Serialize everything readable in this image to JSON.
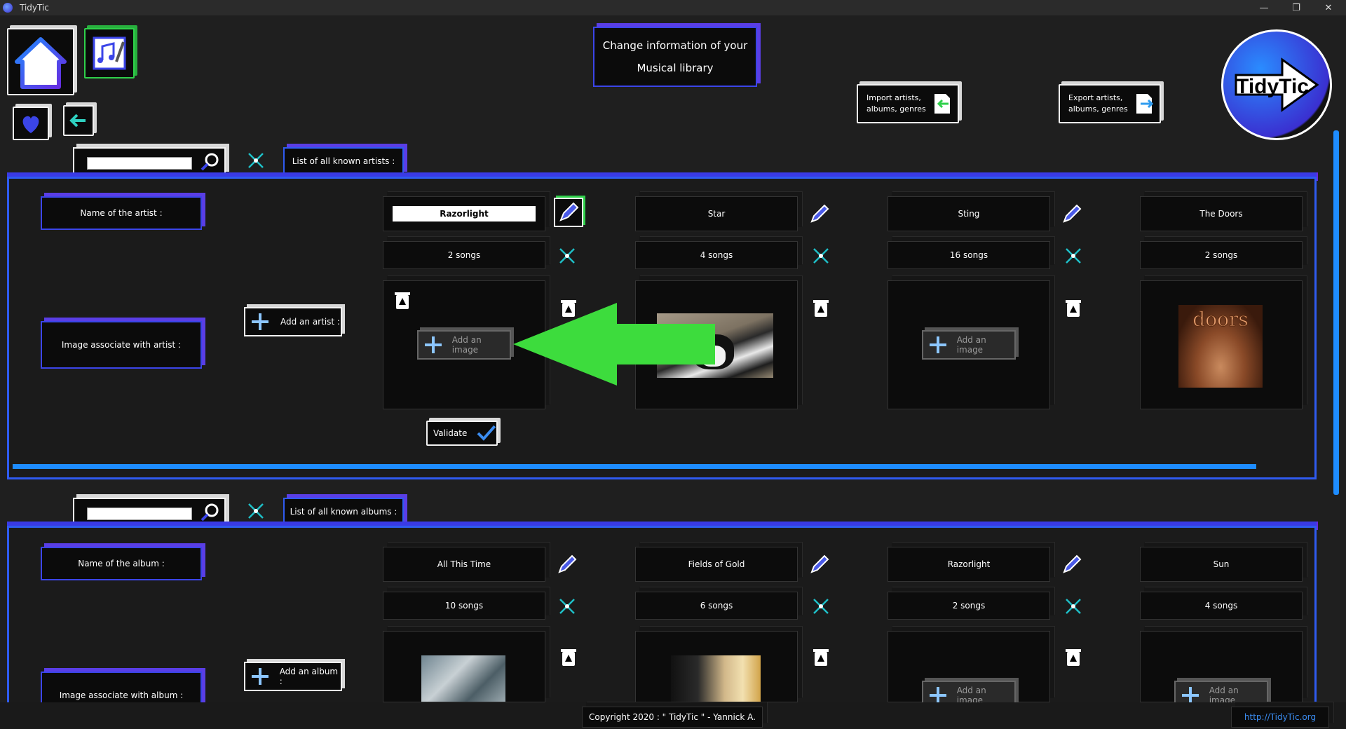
{
  "window": {
    "title": "TidyTic",
    "minimize": "—",
    "restore": "❐",
    "close": "✕"
  },
  "header": {
    "title_line1": "Change information of your",
    "title_line2": "Musical library",
    "import_label_1": "Import artists,",
    "import_label_2": "albums, genres",
    "export_label_1": "Export artists,",
    "export_label_2": "albums, genres",
    "logo_text": "TidyTic"
  },
  "artists": {
    "tab_label": "List of all known artists :",
    "name_label": "Name of the artist :",
    "image_label": "Image associate with artist :",
    "add_label": "Add an artist :",
    "validate_label": "Validate",
    "add_image_label": "Add an image",
    "items": [
      {
        "name": "Razorlight",
        "songs": "2 songs",
        "image": "none",
        "editing": true
      },
      {
        "name": "Star",
        "songs": "4 songs",
        "image": "dog-photo"
      },
      {
        "name": "Sting",
        "songs": "16 songs",
        "image": "none"
      },
      {
        "name": "The Doors",
        "songs": "2 songs",
        "image": "doors-cover"
      }
    ]
  },
  "albums": {
    "tab_label": "List of all known albums :",
    "name_label": "Name of the album :",
    "image_label": "Image associate with album :",
    "add_label": "Add an album :",
    "add_image_label": "Add an image",
    "items": [
      {
        "name": "All This Time",
        "songs": "10 songs",
        "image": "sting-cover-1"
      },
      {
        "name": "Fields of Gold",
        "songs": "6 songs",
        "image": "sting-cover-2"
      },
      {
        "name": "Razorlight",
        "songs": "2 songs",
        "image": "none"
      },
      {
        "name": "Sun",
        "songs": "4 songs",
        "image": "none"
      }
    ]
  },
  "footer": {
    "copyright": "Copyright 2020 : \" TidyTic \" - Yannick A.",
    "link": "http://TidyTic.org"
  },
  "overlay": {
    "arrow_color": "#3ddc3d"
  }
}
